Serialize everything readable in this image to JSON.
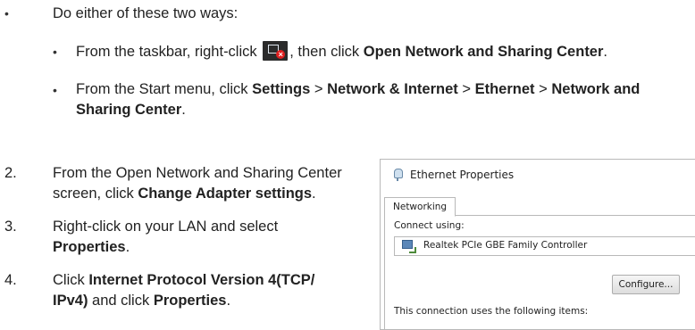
{
  "instructions": {
    "intro": "Do either of these two ways:",
    "way1": {
      "pre": "From the taskbar, right-click",
      "mid": ", then click",
      "target": "Open Network and Sharing Center",
      "end": "."
    },
    "way2": {
      "pre": "From the Start menu, click",
      "settings": "Settings",
      "sep1": ">",
      "network": "Network & Internet",
      "sep2": ">",
      "ethernet": "Ethernet",
      "sep3": ">",
      "target_line1": "Network and",
      "target_line2": "Sharing Center",
      "end": "."
    },
    "steps": [
      {
        "num": "2.",
        "line1": "From the Open Network and Sharing Center",
        "line2_pre": "screen, click",
        "line2_bold": "Change Adapter settings",
        "line2_end": "."
      },
      {
        "num": "3.",
        "line1": "Right-click on your LAN and select",
        "line2_bold": "Properties",
        "line2_end": "."
      },
      {
        "num": "4.",
        "line1_pre": "Click",
        "line1_bold": "Internet Protocol Version 4(TCP/",
        "line2_bold": "IPv4)",
        "line2_mid": "and click",
        "line2_bold2": "Properties",
        "line2_end": "."
      }
    ]
  },
  "dialog": {
    "title": "Ethernet Properties",
    "tab": "Networking",
    "connect_using_label": "Connect using:",
    "adapter": "Realtek PCIe GBE Family Controller",
    "configure_button": "Configure...",
    "items_label": "This connection uses the following items:",
    "adapter_icon": "network-adapter-icon",
    "title_icon": "ethernet-plug-icon"
  },
  "taskbar_icon": "network-disconnected-icon",
  "colors": {
    "text": "#222222",
    "icon_bg": "#2b2b2b",
    "error_red": "#e02020"
  }
}
